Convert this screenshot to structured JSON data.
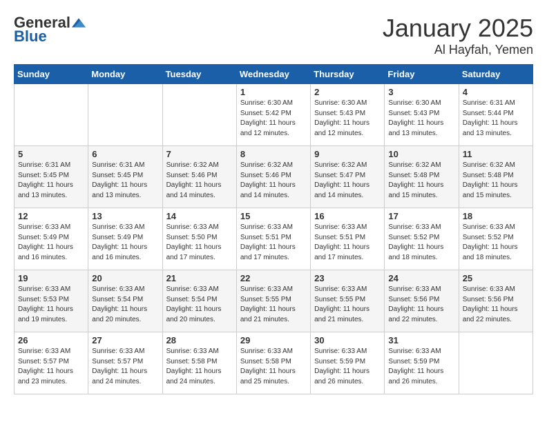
{
  "header": {
    "logo_general": "General",
    "logo_blue": "Blue",
    "month": "January 2025",
    "location": "Al Hayfah, Yemen"
  },
  "weekdays": [
    "Sunday",
    "Monday",
    "Tuesday",
    "Wednesday",
    "Thursday",
    "Friday",
    "Saturday"
  ],
  "weeks": [
    [
      {
        "day": "",
        "sunrise": "",
        "sunset": "",
        "daylight": ""
      },
      {
        "day": "",
        "sunrise": "",
        "sunset": "",
        "daylight": ""
      },
      {
        "day": "",
        "sunrise": "",
        "sunset": "",
        "daylight": ""
      },
      {
        "day": "1",
        "sunrise": "Sunrise: 6:30 AM",
        "sunset": "Sunset: 5:42 PM",
        "daylight": "Daylight: 11 hours and 12 minutes."
      },
      {
        "day": "2",
        "sunrise": "Sunrise: 6:30 AM",
        "sunset": "Sunset: 5:43 PM",
        "daylight": "Daylight: 11 hours and 12 minutes."
      },
      {
        "day": "3",
        "sunrise": "Sunrise: 6:30 AM",
        "sunset": "Sunset: 5:43 PM",
        "daylight": "Daylight: 11 hours and 13 minutes."
      },
      {
        "day": "4",
        "sunrise": "Sunrise: 6:31 AM",
        "sunset": "Sunset: 5:44 PM",
        "daylight": "Daylight: 11 hours and 13 minutes."
      }
    ],
    [
      {
        "day": "5",
        "sunrise": "Sunrise: 6:31 AM",
        "sunset": "Sunset: 5:45 PM",
        "daylight": "Daylight: 11 hours and 13 minutes."
      },
      {
        "day": "6",
        "sunrise": "Sunrise: 6:31 AM",
        "sunset": "Sunset: 5:45 PM",
        "daylight": "Daylight: 11 hours and 13 minutes."
      },
      {
        "day": "7",
        "sunrise": "Sunrise: 6:32 AM",
        "sunset": "Sunset: 5:46 PM",
        "daylight": "Daylight: 11 hours and 14 minutes."
      },
      {
        "day": "8",
        "sunrise": "Sunrise: 6:32 AM",
        "sunset": "Sunset: 5:46 PM",
        "daylight": "Daylight: 11 hours and 14 minutes."
      },
      {
        "day": "9",
        "sunrise": "Sunrise: 6:32 AM",
        "sunset": "Sunset: 5:47 PM",
        "daylight": "Daylight: 11 hours and 14 minutes."
      },
      {
        "day": "10",
        "sunrise": "Sunrise: 6:32 AM",
        "sunset": "Sunset: 5:48 PM",
        "daylight": "Daylight: 11 hours and 15 minutes."
      },
      {
        "day": "11",
        "sunrise": "Sunrise: 6:32 AM",
        "sunset": "Sunset: 5:48 PM",
        "daylight": "Daylight: 11 hours and 15 minutes."
      }
    ],
    [
      {
        "day": "12",
        "sunrise": "Sunrise: 6:33 AM",
        "sunset": "Sunset: 5:49 PM",
        "daylight": "Daylight: 11 hours and 16 minutes."
      },
      {
        "day": "13",
        "sunrise": "Sunrise: 6:33 AM",
        "sunset": "Sunset: 5:49 PM",
        "daylight": "Daylight: 11 hours and 16 minutes."
      },
      {
        "day": "14",
        "sunrise": "Sunrise: 6:33 AM",
        "sunset": "Sunset: 5:50 PM",
        "daylight": "Daylight: 11 hours and 17 minutes."
      },
      {
        "day": "15",
        "sunrise": "Sunrise: 6:33 AM",
        "sunset": "Sunset: 5:51 PM",
        "daylight": "Daylight: 11 hours and 17 minutes."
      },
      {
        "day": "16",
        "sunrise": "Sunrise: 6:33 AM",
        "sunset": "Sunset: 5:51 PM",
        "daylight": "Daylight: 11 hours and 17 minutes."
      },
      {
        "day": "17",
        "sunrise": "Sunrise: 6:33 AM",
        "sunset": "Sunset: 5:52 PM",
        "daylight": "Daylight: 11 hours and 18 minutes."
      },
      {
        "day": "18",
        "sunrise": "Sunrise: 6:33 AM",
        "sunset": "Sunset: 5:52 PM",
        "daylight": "Daylight: 11 hours and 18 minutes."
      }
    ],
    [
      {
        "day": "19",
        "sunrise": "Sunrise: 6:33 AM",
        "sunset": "Sunset: 5:53 PM",
        "daylight": "Daylight: 11 hours and 19 minutes."
      },
      {
        "day": "20",
        "sunrise": "Sunrise: 6:33 AM",
        "sunset": "Sunset: 5:54 PM",
        "daylight": "Daylight: 11 hours and 20 minutes."
      },
      {
        "day": "21",
        "sunrise": "Sunrise: 6:33 AM",
        "sunset": "Sunset: 5:54 PM",
        "daylight": "Daylight: 11 hours and 20 minutes."
      },
      {
        "day": "22",
        "sunrise": "Sunrise: 6:33 AM",
        "sunset": "Sunset: 5:55 PM",
        "daylight": "Daylight: 11 hours and 21 minutes."
      },
      {
        "day": "23",
        "sunrise": "Sunrise: 6:33 AM",
        "sunset": "Sunset: 5:55 PM",
        "daylight": "Daylight: 11 hours and 21 minutes."
      },
      {
        "day": "24",
        "sunrise": "Sunrise: 6:33 AM",
        "sunset": "Sunset: 5:56 PM",
        "daylight": "Daylight: 11 hours and 22 minutes."
      },
      {
        "day": "25",
        "sunrise": "Sunrise: 6:33 AM",
        "sunset": "Sunset: 5:56 PM",
        "daylight": "Daylight: 11 hours and 22 minutes."
      }
    ],
    [
      {
        "day": "26",
        "sunrise": "Sunrise: 6:33 AM",
        "sunset": "Sunset: 5:57 PM",
        "daylight": "Daylight: 11 hours and 23 minutes."
      },
      {
        "day": "27",
        "sunrise": "Sunrise: 6:33 AM",
        "sunset": "Sunset: 5:57 PM",
        "daylight": "Daylight: 11 hours and 24 minutes."
      },
      {
        "day": "28",
        "sunrise": "Sunrise: 6:33 AM",
        "sunset": "Sunset: 5:58 PM",
        "daylight": "Daylight: 11 hours and 24 minutes."
      },
      {
        "day": "29",
        "sunrise": "Sunrise: 6:33 AM",
        "sunset": "Sunset: 5:58 PM",
        "daylight": "Daylight: 11 hours and 25 minutes."
      },
      {
        "day": "30",
        "sunrise": "Sunrise: 6:33 AM",
        "sunset": "Sunset: 5:59 PM",
        "daylight": "Daylight: 11 hours and 26 minutes."
      },
      {
        "day": "31",
        "sunrise": "Sunrise: 6:33 AM",
        "sunset": "Sunset: 5:59 PM",
        "daylight": "Daylight: 11 hours and 26 minutes."
      },
      {
        "day": "",
        "sunrise": "",
        "sunset": "",
        "daylight": ""
      }
    ]
  ]
}
